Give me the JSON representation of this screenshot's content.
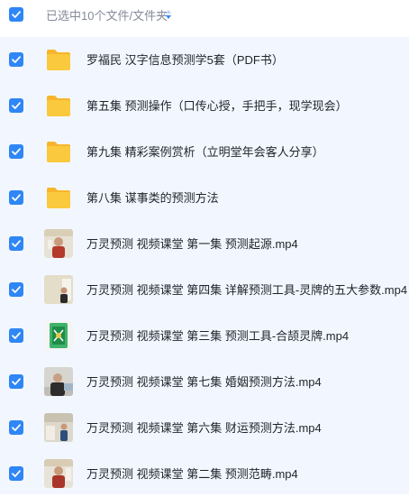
{
  "header": {
    "selection_label": "已选中10个文件/文件夹",
    "sort_icon": "sort-arrows-icon"
  },
  "colors": {
    "accent": "#2f86f6",
    "list_background": "#f2f7ff",
    "folder": "#fbc93d",
    "header_text": "#858b99"
  },
  "files": [
    {
      "name": "罗福民 汉字信息预测学5套（PDF书）",
      "type": "folder",
      "selected": true
    },
    {
      "name": "第五集 预测操作（口传心授，手把手，现学现会）",
      "type": "folder",
      "selected": true
    },
    {
      "name": "第九集 精彩案例赏析（立明堂年会客人分享）",
      "type": "folder",
      "selected": true
    },
    {
      "name": "第八集 谋事类的预测方法",
      "type": "folder",
      "selected": true
    },
    {
      "name": "万灵预测 视频课堂 第一集 预测起源.mp4",
      "type": "video",
      "selected": true
    },
    {
      "name": "万灵预测 视频课堂 第四集 详解预测工具-灵牌的五大参数.mp4",
      "type": "video",
      "selected": true
    },
    {
      "name": "万灵预测 视频课堂 第三集 预测工具-合颉灵牌.mp4",
      "type": "video",
      "selected": true
    },
    {
      "name": "万灵预测 视频课堂 第七集 婚姻预测方法.mp4",
      "type": "video",
      "selected": true
    },
    {
      "name": "万灵预测 视频课堂 第六集 财运预测方法.mp4",
      "type": "video",
      "selected": true
    },
    {
      "name": "万灵预测 视频课堂 第二集 预测范畴.mp4",
      "type": "video",
      "selected": true
    }
  ]
}
